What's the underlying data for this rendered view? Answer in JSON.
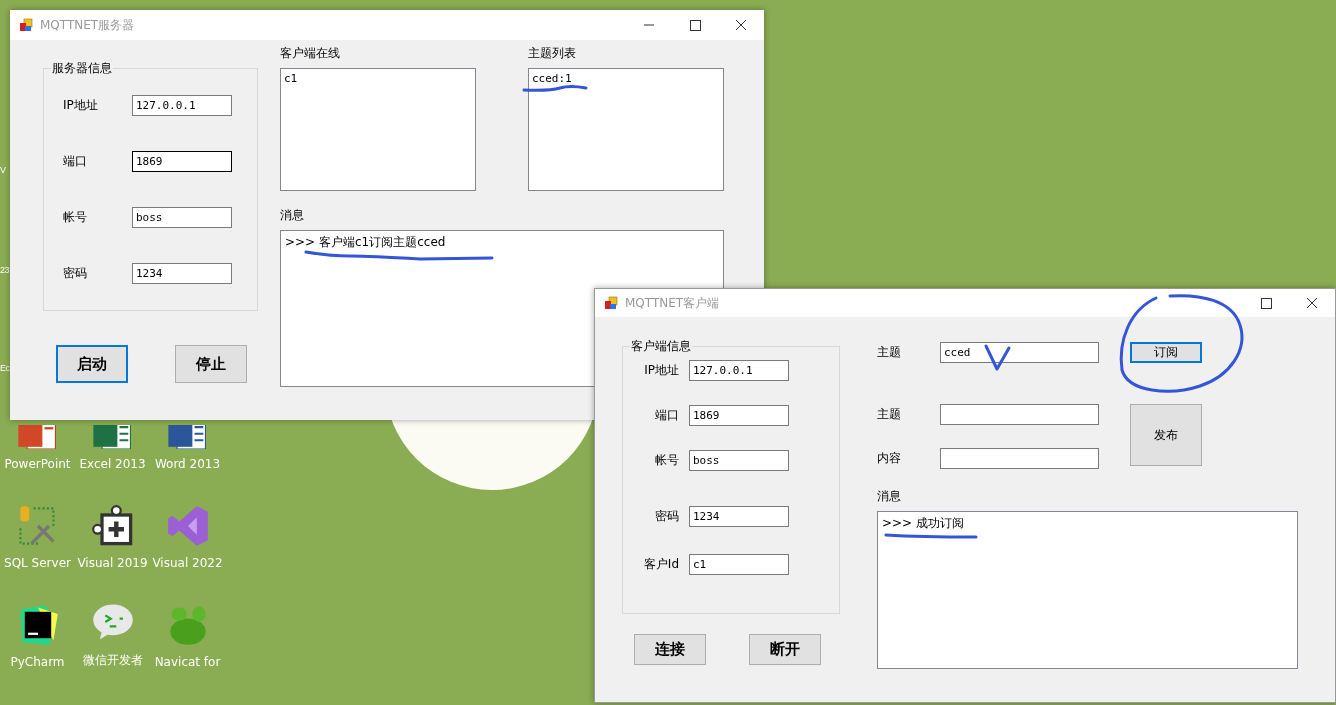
{
  "desktop": {
    "partial_labels": [
      "V",
      "23",
      "Ec"
    ],
    "icons": [
      {
        "label": "PowerPoint",
        "kind": "powerpoint"
      },
      {
        "label": "Excel 2013",
        "kind": "excel"
      },
      {
        "label": "Word 2013",
        "kind": "word"
      },
      {
        "label": "SQL Server",
        "kind": "sqlserver"
      },
      {
        "label": "Visual 2019",
        "kind": "installer"
      },
      {
        "label": "Visual 2022",
        "kind": "visualstudio"
      },
      {
        "label": "PyCharm",
        "kind": "pycharm"
      },
      {
        "label": "微信开发者",
        "kind": "wechatdev"
      },
      {
        "label": "Navicat for",
        "kind": "navicat"
      }
    ]
  },
  "server_window": {
    "title": "MQTTNET服务器",
    "group": {
      "title": "服务器信息",
      "fields": [
        {
          "label": "IP地址",
          "value": "127.0.0.1",
          "focused": false
        },
        {
          "label": "端口",
          "value": "1869",
          "focused": true
        },
        {
          "label": "帐号",
          "value": "boss",
          "focused": false
        },
        {
          "label": "密码",
          "value": "1234",
          "focused": false
        }
      ]
    },
    "buttons": [
      {
        "label": "启动",
        "focused": true
      },
      {
        "label": "停止",
        "focused": false
      }
    ],
    "clients": {
      "label": "客户端在线",
      "items": [
        "c1"
      ]
    },
    "topics": {
      "label": "主题列表",
      "items": [
        "cced:1"
      ]
    },
    "messages": {
      "label": "消息",
      "lines": [
        ">>> 客户端c1订阅主题cced"
      ]
    }
  },
  "client_window": {
    "title": "MQTTNET客户端",
    "group": {
      "title": "客户端信息",
      "fields": [
        {
          "label": "IP地址",
          "value": "127.0.0.1",
          "focused": false
        },
        {
          "label": "端口",
          "value": "1869",
          "focused": false
        },
        {
          "label": "帐号",
          "value": "boss",
          "focused": false
        },
        {
          "label": "密码",
          "value": "1234",
          "focused": false
        },
        {
          "label": "客户Id",
          "value": "c1",
          "focused": false
        }
      ]
    },
    "buttons": [
      {
        "label": "连接",
        "focused": false
      },
      {
        "label": "断开",
        "focused": false
      }
    ],
    "subscribe": {
      "label": "主题",
      "value": "cced",
      "button": "订阅",
      "button_focused": true
    },
    "publish": {
      "topic_label": "主题",
      "content_label": "内容",
      "button": "发布"
    },
    "messages": {
      "label": "消息",
      "lines": [
        ">>> 成功订阅"
      ]
    }
  }
}
